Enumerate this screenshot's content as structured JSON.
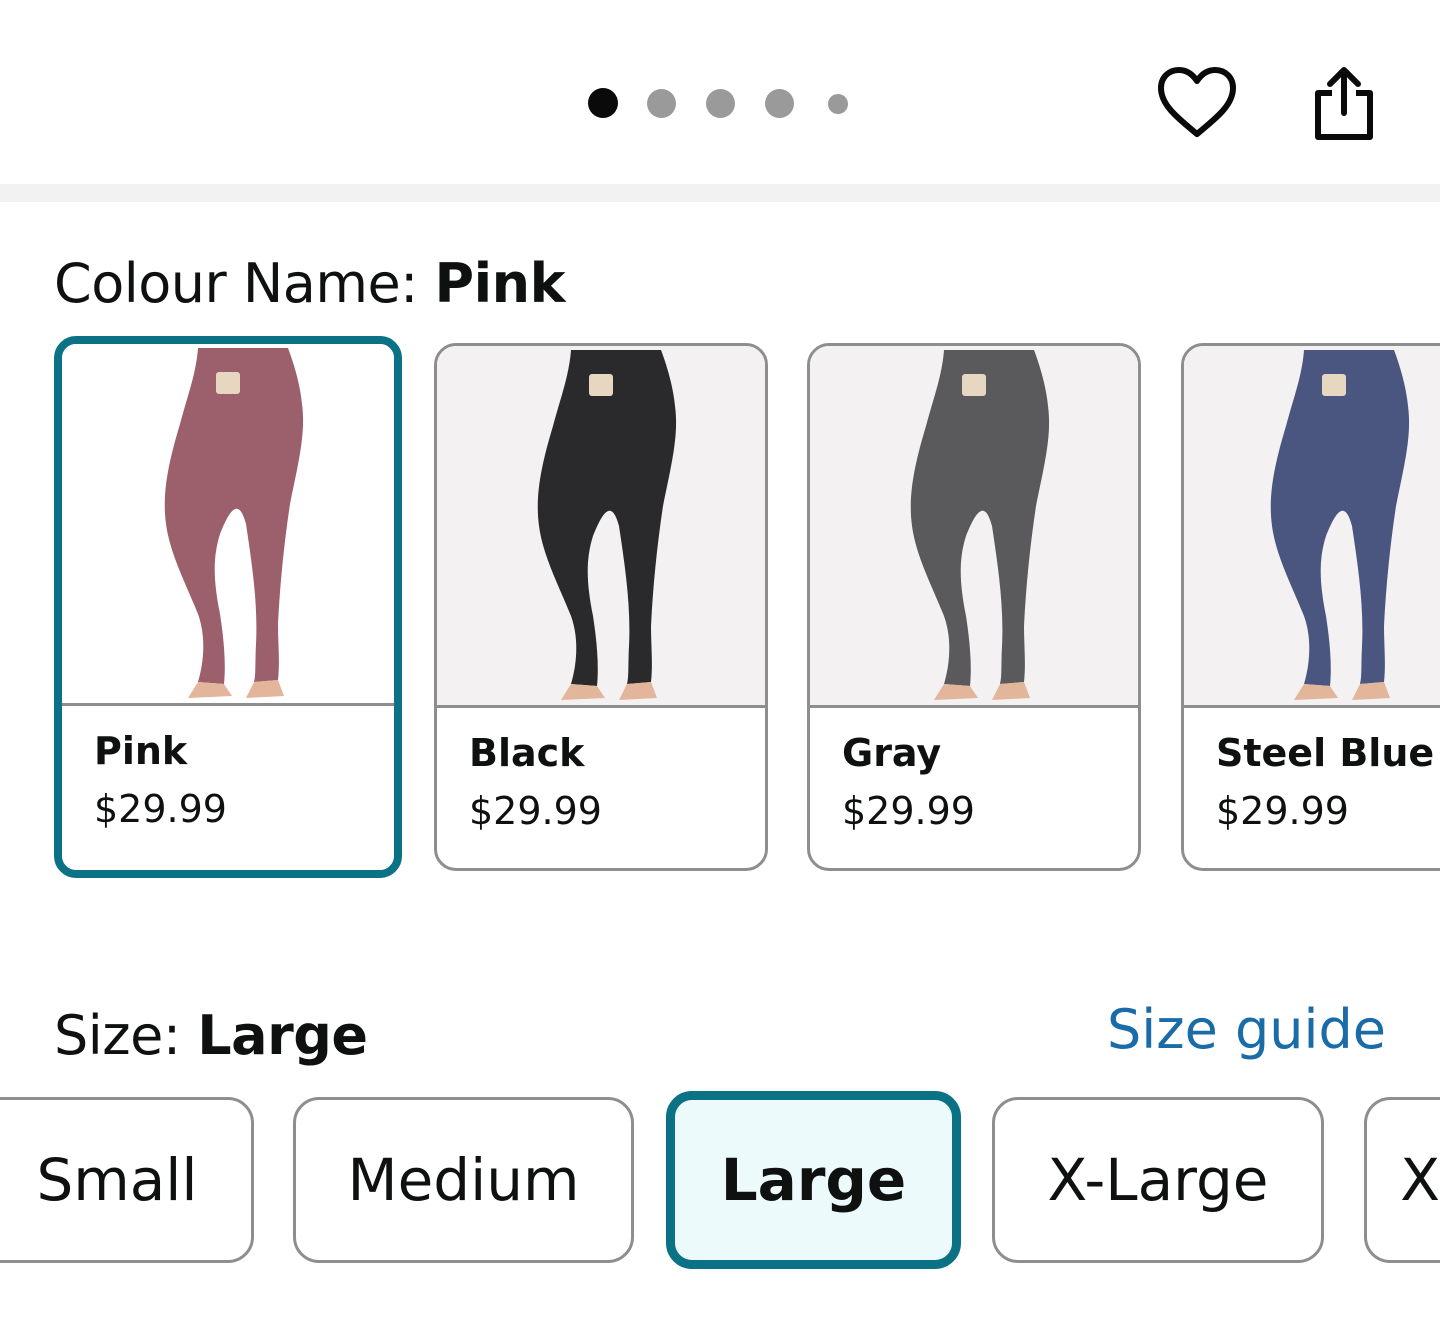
{
  "carousel": {
    "dots": [
      {
        "active": true
      },
      {
        "active": false
      },
      {
        "active": false
      },
      {
        "active": false
      },
      {
        "active": false
      }
    ]
  },
  "actions": {
    "favorite_icon": "heart-icon",
    "share_icon": "share-icon"
  },
  "colour": {
    "label": "Colour Name: ",
    "selected": "Pink",
    "swatches": [
      {
        "name": "Pink",
        "price": "$29.99",
        "color": "#9c5f6c",
        "selected": true
      },
      {
        "name": "Black",
        "price": "$29.99",
        "color": "#2a2a2c",
        "selected": false
      },
      {
        "name": "Gray",
        "price": "$29.99",
        "color": "#5a5a5c",
        "selected": false
      },
      {
        "name": "Steel Blue",
        "price": "$29.99",
        "color": "#4a5680",
        "selected": false
      }
    ]
  },
  "size": {
    "label": "Size: ",
    "selected": "Large",
    "guide_link": "Size guide",
    "options": [
      "Small",
      "Medium",
      "Large",
      "X-Large",
      "X"
    ]
  },
  "colors": {
    "accent": "#0b7285",
    "link": "#1a6ca8",
    "selected_bg": "#edfafc"
  }
}
